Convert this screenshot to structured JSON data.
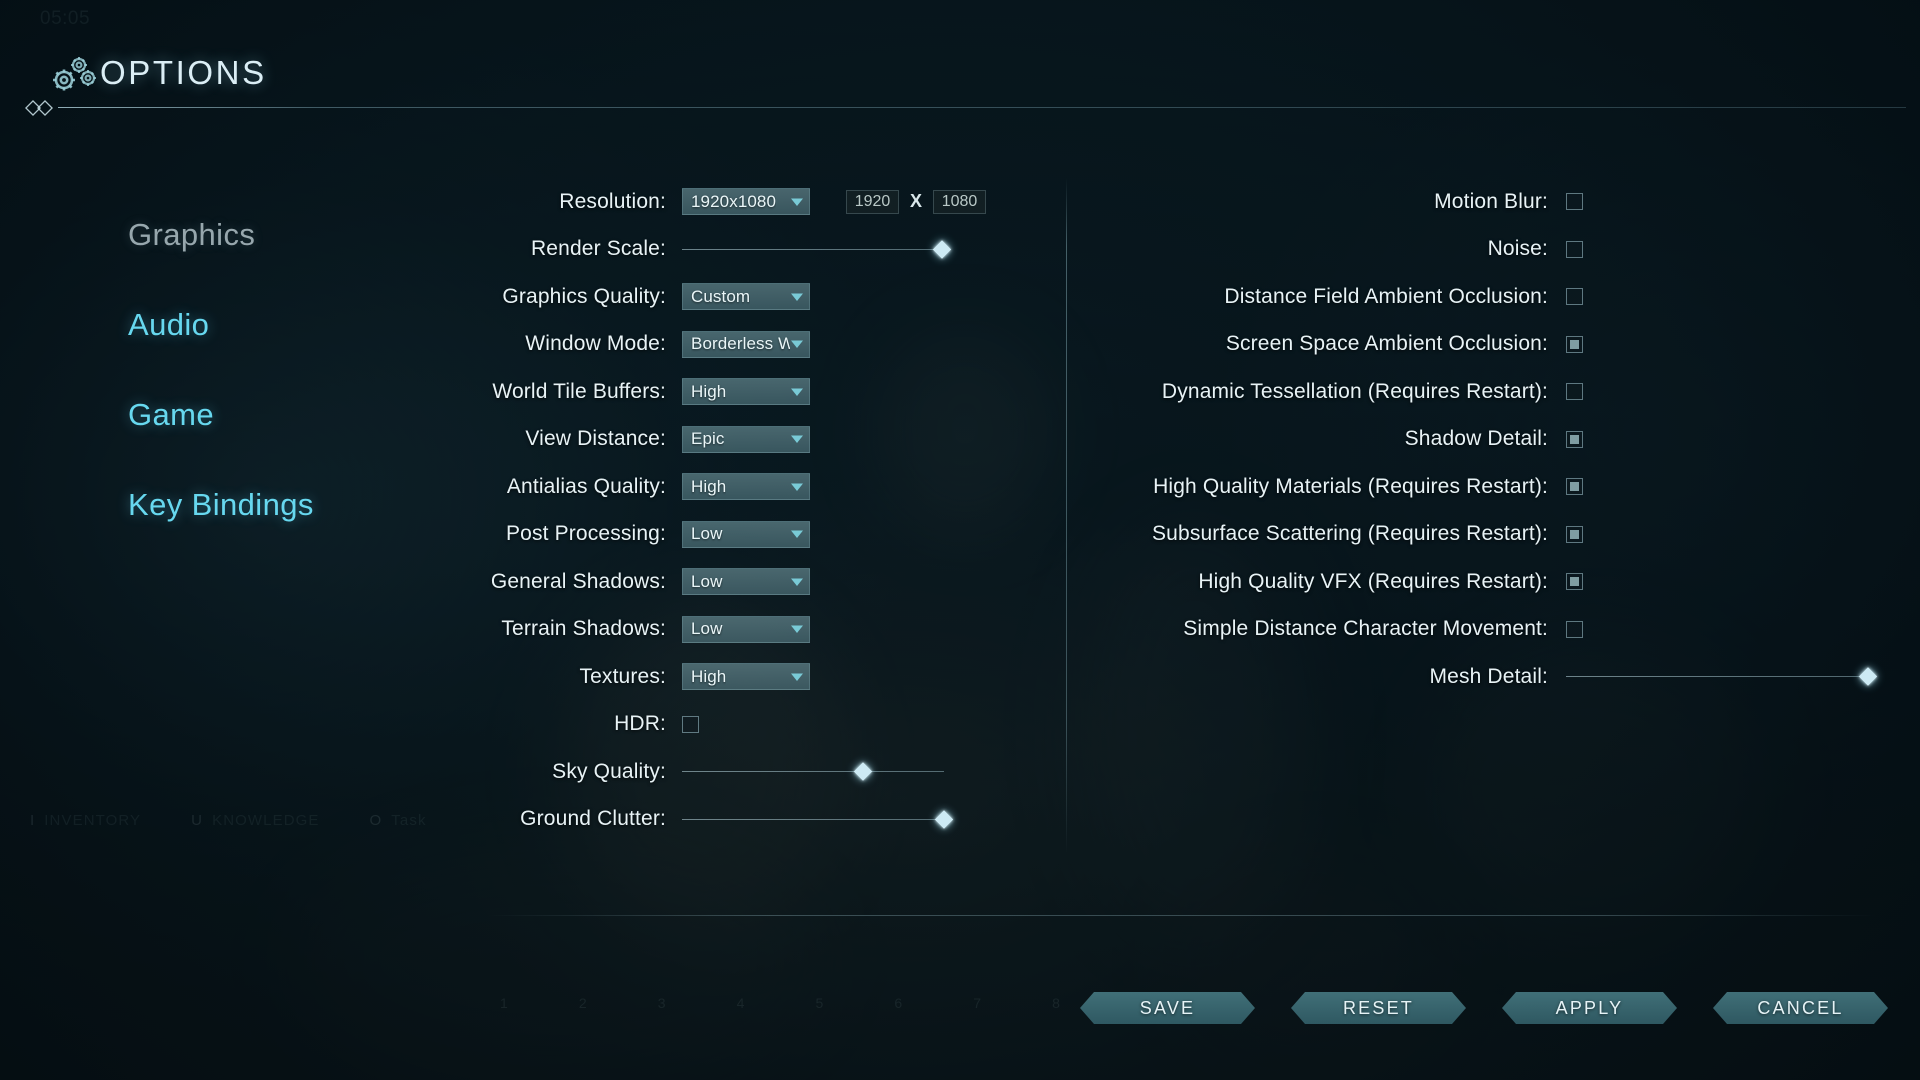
{
  "header": {
    "title": "OPTIONS",
    "gear_icon": "gears-icon"
  },
  "sidebar": {
    "items": [
      {
        "label": "Graphics",
        "state": "active"
      },
      {
        "label": "Audio",
        "state": "idle"
      },
      {
        "label": "Game",
        "state": "idle"
      },
      {
        "label": "Key Bindings",
        "state": "idle"
      }
    ]
  },
  "left_column": {
    "resolution": {
      "label": "Resolution:",
      "value": "1920x1080",
      "width_value": "1920",
      "height_value": "1080",
      "separator": "X"
    },
    "render_scale": {
      "label": "Render Scale:",
      "value_pct": 100
    },
    "graphics_quality": {
      "label": "Graphics Quality:",
      "value": "Custom"
    },
    "window_mode": {
      "label": "Window Mode:",
      "value": "Borderless W"
    },
    "world_tile_buffers": {
      "label": "World Tile Buffers:",
      "value": "High"
    },
    "view_distance": {
      "label": "View Distance:",
      "value": "Epic"
    },
    "antialias_quality": {
      "label": "Antialias Quality:",
      "value": "High"
    },
    "post_processing": {
      "label": "Post Processing:",
      "value": "Low"
    },
    "general_shadows": {
      "label": "General Shadows:",
      "value": "Low"
    },
    "terrain_shadows": {
      "label": "Terrain Shadows:",
      "value": "Low"
    },
    "textures": {
      "label": "Textures:",
      "value": "High"
    },
    "hdr": {
      "label": "HDR:",
      "checked": false
    },
    "sky_quality": {
      "label": "Sky Quality:",
      "value_pct": 69
    },
    "ground_clutter": {
      "label": "Ground Clutter:",
      "value_pct": 100
    }
  },
  "right_column": {
    "motion_blur": {
      "label": "Motion Blur:",
      "checked": false
    },
    "noise": {
      "label": "Noise:",
      "checked": false
    },
    "dfao": {
      "label": "Distance Field Ambient Occlusion:",
      "checked": false
    },
    "ssao": {
      "label": "Screen Space Ambient Occlusion:",
      "checked": true
    },
    "dynamic_tessellation": {
      "label": "Dynamic Tessellation (Requires Restart):",
      "checked": false
    },
    "shadow_detail": {
      "label": "Shadow Detail:",
      "checked": true
    },
    "hq_materials": {
      "label": "High Quality Materials (Requires Restart):",
      "checked": true
    },
    "subsurface_scattering": {
      "label": "Subsurface Scattering (Requires Restart):",
      "checked": true
    },
    "hq_vfx": {
      "label": "High Quality VFX (Requires Restart):",
      "checked": true
    },
    "simple_distance_char": {
      "label": "Simple Distance Character Movement:",
      "checked": false
    },
    "mesh_detail": {
      "label": "Mesh Detail:",
      "value_pct": 100
    }
  },
  "footer": {
    "buttons": [
      {
        "label": "SAVE"
      },
      {
        "label": "RESET"
      },
      {
        "label": "APPLY"
      },
      {
        "label": "CANCEL"
      }
    ]
  },
  "background_hud": {
    "clock": "05:05",
    "shortcuts": [
      {
        "key": "I",
        "label": "INVENTORY"
      },
      {
        "key": "U",
        "label": "KNOWLEDGE"
      },
      {
        "key": "O",
        "label": "Task"
      }
    ],
    "hotbar": [
      "1",
      "2",
      "3",
      "4",
      "5",
      "6",
      "7",
      "8"
    ]
  },
  "colors": {
    "accent_cyan": "#67d8ef",
    "label_text": "#e8f3f6",
    "dropdown_fill": "#6f96a0",
    "button_fill": "#487c85",
    "active_nav": "#97a7ad"
  }
}
